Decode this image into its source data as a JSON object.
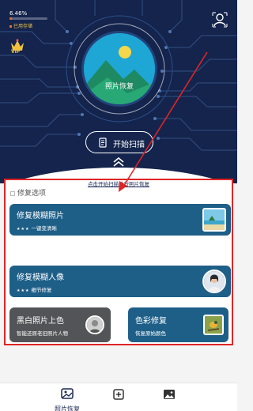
{
  "status": {
    "storage_percent_text": "6.46%",
    "storage_fraction": 0.0646,
    "storage_label": "已用存储"
  },
  "vip": {
    "badge": "VIP",
    "icon": "crown-icon"
  },
  "profile": {
    "icon": "user-profile-icon"
  },
  "hero": {
    "logo_caption": "照片恢复",
    "scan_button_label": "开始扫描",
    "hint_text": "点击开始扫描进行照片恢复"
  },
  "repair": {
    "section_title": "修复选项",
    "cards": [
      {
        "title": "修复模糊照片",
        "stars": "★★★",
        "subtitle": "一键变清晰"
      },
      {
        "title": "修复模糊人像",
        "stars": "★★★",
        "subtitle": "细节修复"
      },
      {
        "title": "黑白照片上色",
        "subtitle": "智能还原老旧照片人物"
      },
      {
        "title": "色彩修复",
        "subtitle": "恢复原始颜色"
      }
    ]
  },
  "nav": {
    "items": [
      {
        "label": "照片恢复",
        "icon": "photo-recovery-icon",
        "active": true
      },
      {
        "label": "",
        "icon": "add-photo-icon",
        "active": false
      },
      {
        "label": "",
        "icon": "gallery-icon",
        "active": false
      }
    ]
  },
  "colors": {
    "hero_bg": "#14244c",
    "card_blue": "#1e5f88",
    "card_gray": "#535457",
    "accent_orange": "#e8712c",
    "highlight_red": "#e02525"
  }
}
